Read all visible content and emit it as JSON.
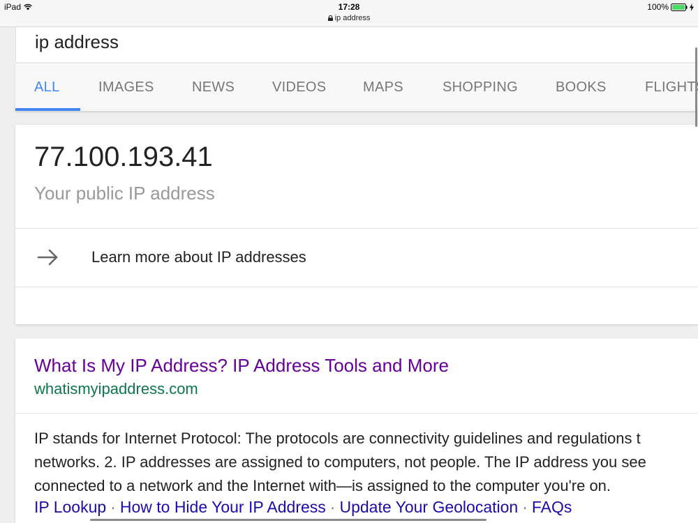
{
  "status_bar": {
    "device": "iPad",
    "time": "17:28",
    "url": "ip address",
    "battery": "100%"
  },
  "search": {
    "query": "ip address"
  },
  "tabs": [
    {
      "label": "ALL",
      "active": true
    },
    {
      "label": "IMAGES",
      "active": false
    },
    {
      "label": "NEWS",
      "active": false
    },
    {
      "label": "VIDEOS",
      "active": false
    },
    {
      "label": "MAPS",
      "active": false
    },
    {
      "label": "SHOPPING",
      "active": false
    },
    {
      "label": "BOOKS",
      "active": false
    },
    {
      "label": "FLIGHTS",
      "active": false
    }
  ],
  "ip_card": {
    "ip": "77.100.193.41",
    "caption": "Your public IP address",
    "learn_more": "Learn more about IP addresses"
  },
  "result": {
    "title": "What Is My IP Address? IP Address Tools and More",
    "url": "whatismyipaddress.com",
    "snippet_lines": [
      "IP stands for Internet Protocol: The protocols are connectivity guidelines and regulations t",
      "networks. 2. IP addresses are assigned to computers, not people. The IP address you see",
      "connected to a network and the Internet with—is assigned to the computer you're on."
    ],
    "sitelinks": [
      "IP Lookup",
      "How to Hide Your IP Address",
      "Update Your Geolocation",
      "FAQs"
    ],
    "sitelink_separator": "·"
  },
  "colors": {
    "accent": "#4285f4",
    "visited_link": "#660099",
    "url_green": "#0e774a",
    "link_blue": "#1a0dab",
    "battery_green": "#4cd964"
  },
  "icons": [
    "wifi-icon",
    "lock-icon",
    "battery-icon",
    "charging-bolt-icon",
    "arrow-right-icon"
  ]
}
